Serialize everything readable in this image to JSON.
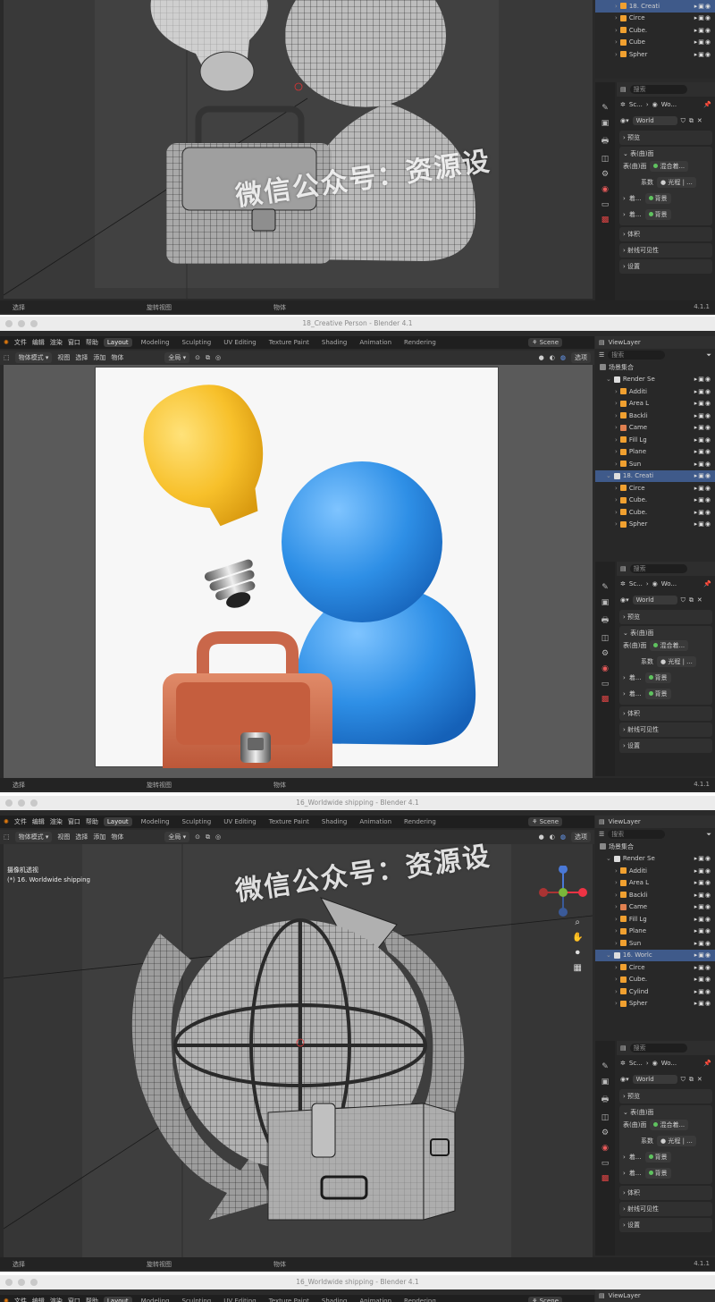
{
  "windows": [
    {
      "title": "",
      "statusbar": {
        "left": "选择",
        "mid": "旋转视图",
        "right": "物体",
        "version": "4.1.1"
      }
    },
    {
      "title": "18_Creative Person - Blender 4.1",
      "statusbar": {
        "left": "选择",
        "mid": "旋转视图",
        "right": "物体",
        "version": "4.1.1"
      }
    },
    {
      "title": "16_Worldwide shipping - Blender 4.1",
      "statusbar": {
        "left": "选择",
        "mid": "旋转视图",
        "right": "物体",
        "version": "4.1.1"
      }
    },
    {
      "title": "16_Worldwide shipping - Blender 4.1"
    }
  ],
  "menu": {
    "file": "文件",
    "edit": "编辑",
    "render": "渲染",
    "window": "窗口",
    "help": "帮助",
    "workspaces": [
      "Layout",
      "Modeling",
      "Sculpting",
      "UV Editing",
      "Texture Paint",
      "Shading",
      "Animation",
      "Rendering"
    ],
    "scene": "Scene",
    "viewlayer": "ViewLayer"
  },
  "toolbar": {
    "mode": "物体模式",
    "view": "视图",
    "select": "选择",
    "add": "添加",
    "object": "物体",
    "orientation": "全局",
    "options": "选项"
  },
  "viewport3": {
    "overlay_title": "摄像机透视",
    "overlay_sub": "(*) 16.  Worldwide shipping"
  },
  "watermark": "微信公众号：资源设",
  "outliner": {
    "scene_collection": "场景集合",
    "search_placeholder": "搜索",
    "p1_rows": [
      {
        "label": "18. Creati",
        "sel": true
      },
      {
        "label": "Circe"
      },
      {
        "label": "Cube."
      },
      {
        "label": "Cube"
      },
      {
        "label": "Spher"
      }
    ],
    "p2_rows": [
      {
        "label": "场景集合",
        "kind": "root"
      },
      {
        "label": "Render Se",
        "kind": "coll"
      },
      {
        "label": "Additi",
        "kind": "light"
      },
      {
        "label": "Area L",
        "kind": "light"
      },
      {
        "label": "Backli",
        "kind": "light"
      },
      {
        "label": "Came",
        "kind": "cam"
      },
      {
        "label": "Fill Lg",
        "kind": "light"
      },
      {
        "label": "Plane",
        "kind": "mesh"
      },
      {
        "label": "Sun",
        "kind": "light"
      },
      {
        "label": "18. Creati",
        "kind": "coll",
        "sel": true
      },
      {
        "label": "Circe",
        "kind": "mesh"
      },
      {
        "label": "Cube.",
        "kind": "mesh"
      },
      {
        "label": "Cube.",
        "kind": "mesh"
      },
      {
        "label": "Spher",
        "kind": "mesh"
      }
    ],
    "p3_rows": [
      {
        "label": "场景集合",
        "kind": "root"
      },
      {
        "label": "Render Se",
        "kind": "coll"
      },
      {
        "label": "Additi",
        "kind": "light"
      },
      {
        "label": "Area L",
        "kind": "light"
      },
      {
        "label": "Backli",
        "kind": "light"
      },
      {
        "label": "Came",
        "kind": "cam"
      },
      {
        "label": "Fill Lg",
        "kind": "light"
      },
      {
        "label": "Plane",
        "kind": "mesh"
      },
      {
        "label": "Sun",
        "kind": "light"
      },
      {
        "label": "16. Worlc",
        "kind": "coll",
        "sel": true
      },
      {
        "label": "Circe",
        "kind": "mesh"
      },
      {
        "label": "Cube.",
        "kind": "mesh"
      },
      {
        "label": "Cylind",
        "kind": "mesh"
      },
      {
        "label": "Spher",
        "kind": "mesh"
      }
    ]
  },
  "properties": {
    "search_placeholder": "搜索",
    "breadcrumb_scene": "Sc...",
    "breadcrumb_world": "Wo...",
    "world_name": "World",
    "preview": "预览",
    "surface": "表(曲)面",
    "surface_label": "表(曲)面",
    "surface_value": "混合着...",
    "factor_label": "系数",
    "factor_value": "光程 | ...",
    "input1_label": "着...",
    "input1_value": "背景",
    "input2_label": "着...",
    "input2_value": "背景",
    "volume": "体积",
    "ray_visibility": "射线可见性",
    "settings": "设置"
  }
}
